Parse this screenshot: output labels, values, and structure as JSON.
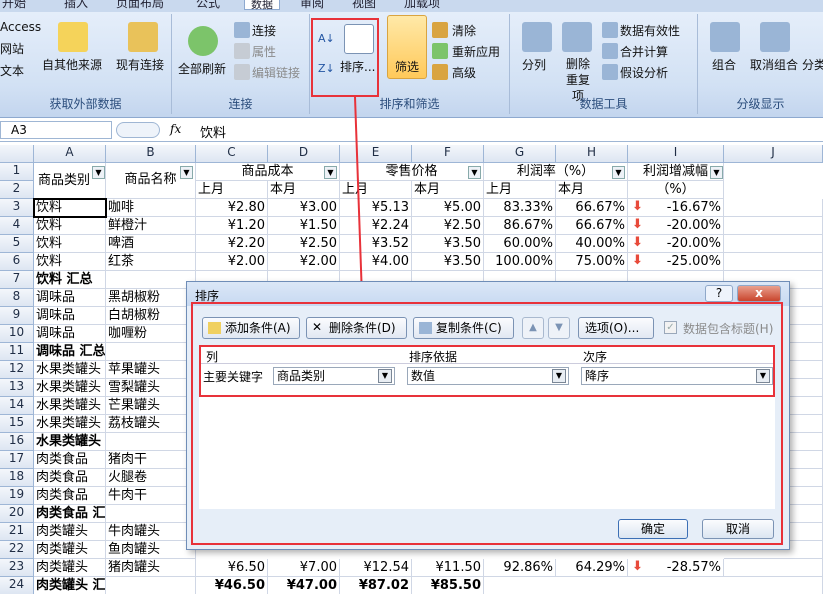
{
  "ribbon": {
    "tabs": [
      "开始",
      "插入",
      "页面布局",
      "公式",
      "数据",
      "审阅",
      "视图",
      "加载项"
    ],
    "active_tab": "数据",
    "external": {
      "access": "Access",
      "web": "网站",
      "text": "文本",
      "other_sources": "自其他来源",
      "existing": "现有连接",
      "label": "获取外部数据"
    },
    "connections": {
      "refresh_all": "全部刷新",
      "connections": "连接",
      "properties": "属性",
      "edit_links": "编辑链接",
      "label": "连接"
    },
    "sort_filter": {
      "sort": "排序...",
      "filter": "筛选",
      "clear": "清除",
      "reapply": "重新应用",
      "advanced": "高级",
      "label": "排序和筛选"
    },
    "data_tools": {
      "split": "分列",
      "remove_dup": "删除重复项",
      "validation": "数据有效性",
      "consolidate": "合并计算",
      "whatif": "假设分析",
      "label": "数据工具"
    },
    "outline": {
      "group": "组合",
      "ungroup": "取消组合",
      "subtotal": "分类",
      "label": "分级显示"
    }
  },
  "formula_bar": {
    "name_box": "A3",
    "fx": "fx",
    "content": "饮料"
  },
  "columns": [
    "A",
    "B",
    "C",
    "D",
    "E",
    "F",
    "G",
    "H",
    "I",
    "J"
  ],
  "header_row1": {
    "a": "商品类别",
    "b": "商品名称",
    "cd": "商品成本",
    "ef": "零售价格",
    "gh": "利润率（%）",
    "i": "利润增减幅"
  },
  "header_row2": {
    "c": "上月",
    "d": "本月",
    "e": "上月",
    "f": "本月",
    "g": "上月",
    "h": "本月",
    "i": "（%）"
  },
  "row_numbers": [
    "1",
    "2",
    "3",
    "4",
    "5",
    "6",
    "7",
    "8",
    "9",
    "10",
    "11",
    "12",
    "13",
    "14",
    "15",
    "16",
    "17",
    "18",
    "19",
    "20",
    "21",
    "22",
    "23",
    "24"
  ],
  "rows": [
    {
      "a": "饮料",
      "b": "咖啡",
      "c": "¥2.80",
      "d": "¥3.00",
      "e": "¥5.13",
      "f": "¥5.00",
      "g": "83.33%",
      "h": "66.67%",
      "i": "-16.67%"
    },
    {
      "a": "饮料",
      "b": "鲜橙汁",
      "c": "¥1.20",
      "d": "¥1.50",
      "e": "¥2.24",
      "f": "¥2.50",
      "g": "86.67%",
      "h": "66.67%",
      "i": "-20.00%"
    },
    {
      "a": "饮料",
      "b": "啤酒",
      "c": "¥2.20",
      "d": "¥2.50",
      "e": "¥3.52",
      "f": "¥3.50",
      "g": "60.00%",
      "h": "40.00%",
      "i": "-20.00%"
    },
    {
      "a": "饮料",
      "b": "红茶",
      "c": "¥2.00",
      "d": "¥2.00",
      "e": "¥4.00",
      "f": "¥3.50",
      "g": "100.00%",
      "h": "75.00%",
      "i": "-25.00%"
    },
    {
      "a": "饮料 汇总",
      "b": "",
      "c": "",
      "d": "",
      "e": "",
      "f": "",
      "g": "",
      "h": "",
      "i": "",
      "bold": true
    },
    {
      "a": "调味品",
      "b": "黑胡椒粉"
    },
    {
      "a": "调味品",
      "b": "白胡椒粉"
    },
    {
      "a": "调味品",
      "b": "咖喱粉"
    },
    {
      "a": "调味品 汇总",
      "b": "",
      "bold": true
    },
    {
      "a": "水果类罐头",
      "b": "苹果罐头"
    },
    {
      "a": "水果类罐头",
      "b": "雪梨罐头"
    },
    {
      "a": "水果类罐头",
      "b": "芒果罐头"
    },
    {
      "a": "水果类罐头",
      "b": "荔枝罐头"
    },
    {
      "a": "水果类罐头 汇总",
      "b": "",
      "bold": true
    },
    {
      "a": "肉类食品",
      "b": "猪肉干"
    },
    {
      "a": "肉类食品",
      "b": "火腿卷"
    },
    {
      "a": "肉类食品",
      "b": "牛肉干"
    },
    {
      "a": "肉类食品 汇总",
      "b": "",
      "bold": true
    },
    {
      "a": "肉类罐头",
      "b": "牛肉罐头"
    },
    {
      "a": "肉类罐头",
      "b": "鱼肉罐头"
    },
    {
      "a": "肉类罐头",
      "b": "猪肉罐头",
      "c": "¥6.50",
      "d": "¥7.00",
      "e": "¥12.54",
      "f": "¥11.50",
      "g": "92.86%",
      "h": "64.29%",
      "i": "-28.57%"
    },
    {
      "a": "肉类罐头 汇总",
      "b": "",
      "c": "¥46.50",
      "d": "¥47.00",
      "e": "¥87.02",
      "f": "¥85.50",
      "bold": true
    }
  ],
  "dialog": {
    "title": "排序",
    "help": "?",
    "close": "x",
    "add_level": "添加条件(A)",
    "delete_level": "删除条件(D)",
    "copy_level": "复制条件(C)",
    "up": "▲",
    "down": "▼",
    "options": "选项(O)...",
    "has_headers": "数据包含标题(H)",
    "col_header": "列",
    "sorton_header": "排序依据",
    "order_header": "次序",
    "row_label": "主要关键字",
    "column_value": "商品类别",
    "sorton_value": "数值",
    "order_value": "降序",
    "ok": "确定",
    "cancel": "取消"
  },
  "colors": {
    "highlight_red": "#e8323a",
    "ribbon_blue": "#d2e1f4",
    "decrease_arrow": "#e84a3a"
  }
}
